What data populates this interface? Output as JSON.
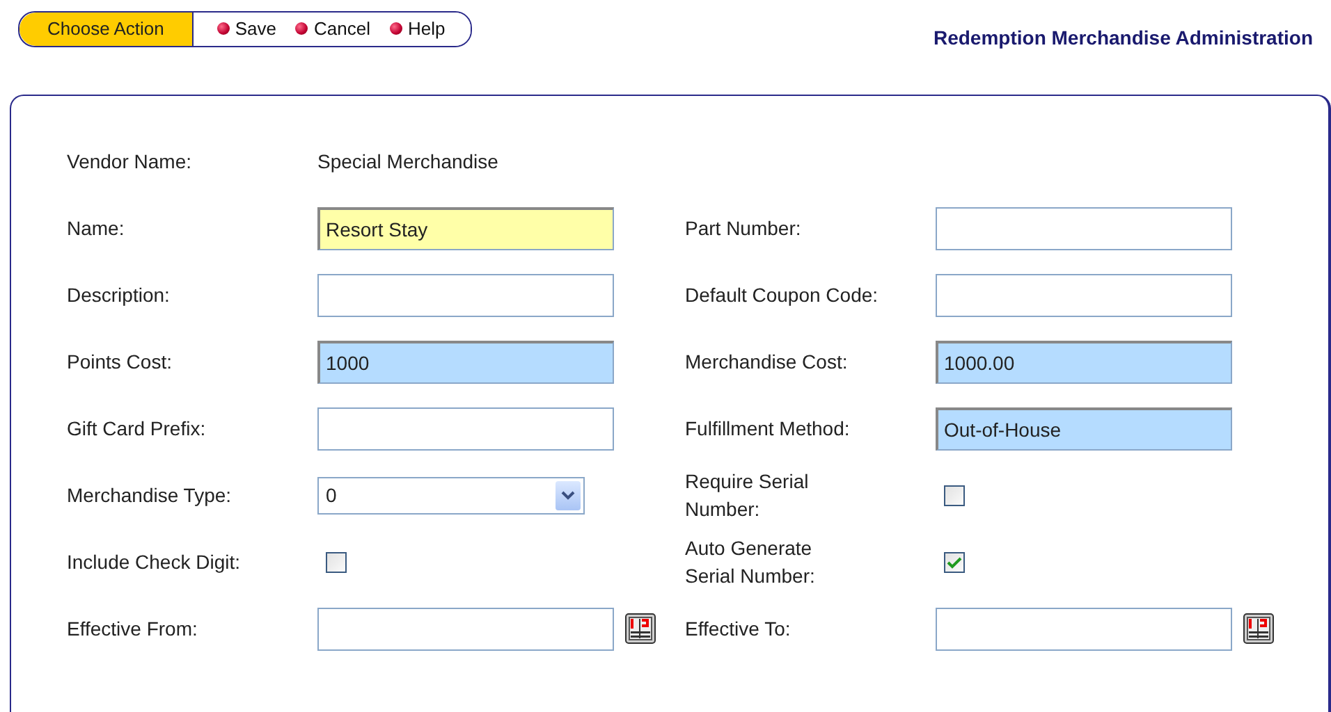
{
  "toolbar": {
    "label": "Choose Action",
    "actions": [
      "Save",
      "Cancel",
      "Help"
    ]
  },
  "page_title": "Redemption Merchandise Administration",
  "form_rows": [
    {
      "left": {
        "label": "Vendor Name:",
        "kind": "static",
        "value": "Special Merchandise"
      }
    },
    {
      "left": {
        "label": "Name:",
        "kind": "required",
        "value": "Resort Stay"
      },
      "right": {
        "label": "Part Number:",
        "kind": "text"
      }
    },
    {
      "left": {
        "label": "Description:",
        "kind": "text"
      },
      "right": {
        "label": "Default Coupon Code:",
        "kind": "text"
      }
    },
    {
      "left": {
        "label": "Points Cost:",
        "kind": "locked",
        "value": "1000"
      },
      "right": {
        "label": "Merchandise Cost:",
        "kind": "locked",
        "value": "1000.00"
      }
    },
    {
      "left": {
        "label": "Gift Card Prefix:",
        "kind": "text"
      },
      "right": {
        "label": "Fulfillment Method:",
        "kind": "locked",
        "value": "Out-of-House"
      }
    },
    {
      "left": {
        "label": "Merchandise Type:",
        "kind": "select",
        "value": "0"
      },
      "right": {
        "label": "Require Serial Number:",
        "kind": "checkbox",
        "checked": false
      }
    },
    {
      "left": {
        "label": "Include Check Digit:",
        "kind": "checkbox",
        "checked": false
      },
      "right": {
        "label": "Auto Generate Serial Number:",
        "kind": "checkbox",
        "checked": true
      }
    },
    {
      "left": {
        "label": "Effective From:",
        "kind": "date"
      },
      "right": {
        "label": "Effective To:",
        "kind": "date"
      }
    }
  ]
}
